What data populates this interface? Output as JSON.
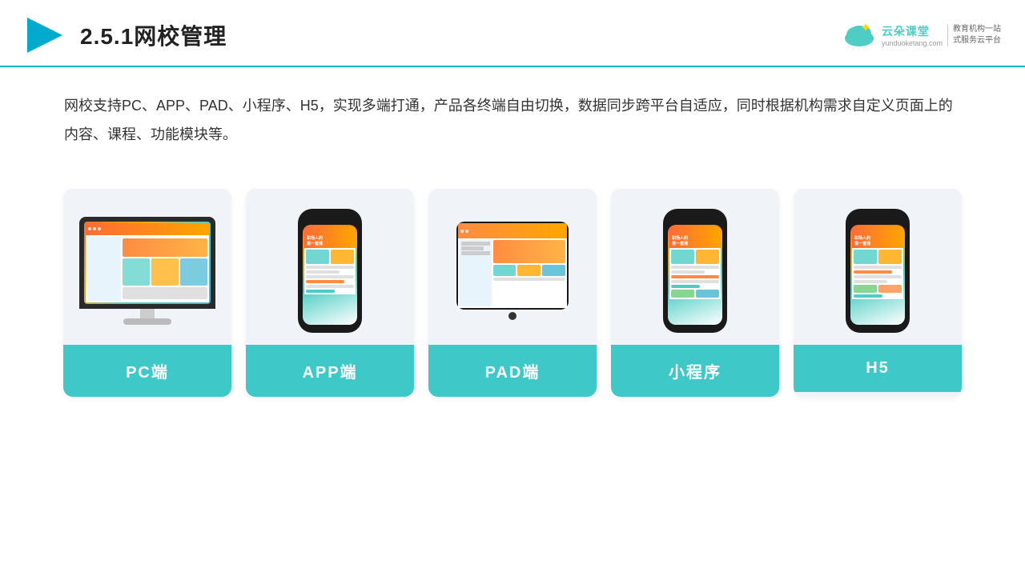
{
  "header": {
    "title": "2.5.1网校管理",
    "logo": {
      "name": "云朵课堂",
      "url": "yunduoketang.com",
      "tagline": "教育机构一站\n式服务云平台"
    }
  },
  "description": {
    "text": "网校支持PC、APP、PAD、小程序、H5，实现多端打通，产品各终端自由切换，数据同步跨平台自适应，同时根据机构需求自定义页面上的内容、课程、功能模块等。"
  },
  "cards": [
    {
      "id": "pc",
      "label": "PC端"
    },
    {
      "id": "app",
      "label": "APP端"
    },
    {
      "id": "pad",
      "label": "PAD端"
    },
    {
      "id": "miniprogram",
      "label": "小程序"
    },
    {
      "id": "h5",
      "label": "H5"
    }
  ],
  "accent_color": "#3ec8c8"
}
